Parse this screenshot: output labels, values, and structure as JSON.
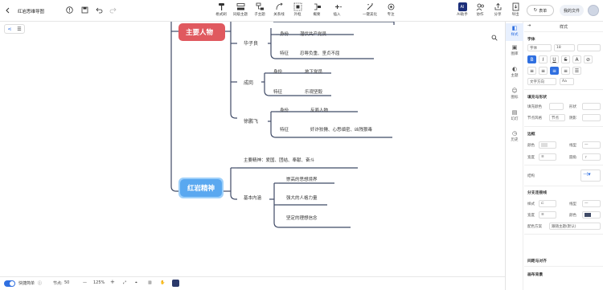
{
  "topbar": {
    "doc_title": "红岩思维导图",
    "tools": [
      {
        "label": "格式刷",
        "icon": "format-brush-icon"
      },
      {
        "label": "同级主题",
        "icon": "sibling-topic-icon"
      },
      {
        "label": "子主题",
        "icon": "child-topic-icon"
      },
      {
        "label": "关系线",
        "icon": "relation-line-icon"
      },
      {
        "label": "外框",
        "icon": "boundary-icon"
      },
      {
        "label": "概要",
        "icon": "summary-icon"
      },
      {
        "label": "插入",
        "icon": "insert-icon"
      },
      {
        "label": "一键美化",
        "icon": "magic-wand-icon"
      },
      {
        "label": "专注",
        "icon": "focus-icon"
      }
    ],
    "ai_label": "AI助手",
    "ai_badge": "AI",
    "collab_label": "协作",
    "share_label": "分享",
    "export_label": "导出",
    "restore_label": "表单",
    "my_files_label": "我的文件"
  },
  "mindmap": {
    "branch1": {
      "title": "主要人物",
      "people": [
        {
          "name": "华子良",
          "rows": [
            {
              "k": "身份",
              "v": "潜伏共产党员"
            },
            {
              "k": "特征",
              "v": "忍辱负重、坚贞不屈"
            }
          ]
        },
        {
          "name": "成岗",
          "rows": [
            {
              "k": "身份",
              "v": "地下党员"
            },
            {
              "k": "特征",
              "v": "乐观坚毅"
            }
          ]
        },
        {
          "name": "徐鹏飞",
          "rows": [
            {
              "k": "身份",
              "v": "反面人物"
            },
            {
              "k": "特征",
              "v": "奸诈狡猾、心思缜密、凶残狠毒"
            }
          ]
        }
      ]
    },
    "branch2": {
      "title": "红岩精神",
      "main_spirit": "主要精神：爱国、团结、奉献、奋斗",
      "content_label": "基本内涵",
      "contents": [
        "崇高的思想境界",
        "强大的人格力量",
        "坚定的理想信念"
      ]
    }
  },
  "rightpanel": {
    "tabs": [
      {
        "label": "样式",
        "icon": "style-icon"
      },
      {
        "label": "图库",
        "icon": "gallery-icon"
      },
      {
        "label": "主题",
        "icon": "theme-icon"
      },
      {
        "label": "图标",
        "icon": "emoji-icon"
      },
      {
        "label": "幻灯",
        "icon": "slides-icon"
      },
      {
        "label": "历史",
        "icon": "history-icon"
      }
    ],
    "title": "样式",
    "font_section": "字体",
    "font_family": "字体",
    "font_size": "18",
    "text_dir": "文字方向",
    "fill_section": "填充与形状",
    "fill_color_label": "填充颜色",
    "shape_label": "形状",
    "node_style_label": "节点风格",
    "node_style_value": "节点",
    "shadow_label": "阴影",
    "border_section": "边框",
    "color_label": "颜色",
    "line_type_label": "线型",
    "width_label": "宽度",
    "corner_label": "圆角",
    "structure_label": "结构",
    "branch_line_section": "分支连接线",
    "style_label": "样式",
    "line_type2_label": "线型",
    "width2_label": "宽度",
    "color2_label": "颜色",
    "color_scheme_label": "配色方案",
    "color_scheme_value": "跟随主题(默认)",
    "spacing_section": "间距与对齐",
    "canvas_section": "画布背景",
    "accent": "#2f6fe0",
    "branch_color_line": "#3f4a66"
  },
  "bottombar": {
    "shortcut_label": "快捷简单",
    "node_count_label": "节点:",
    "node_count": "50",
    "zoom": "125%"
  },
  "colors": {
    "branch1_fill": "#e0595f",
    "branch2_fill": "#5aa8f0",
    "line": "#3f4a66"
  }
}
